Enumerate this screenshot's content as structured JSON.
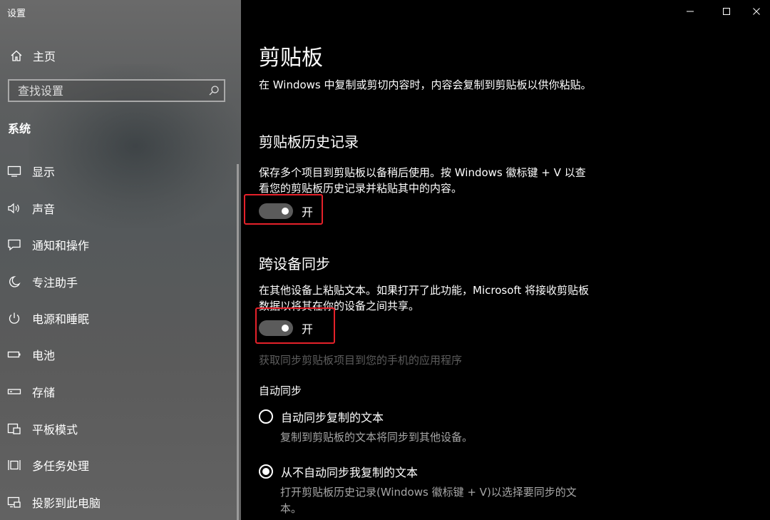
{
  "window": {
    "title": "设置",
    "controls": [
      "minimize",
      "maximize",
      "close"
    ]
  },
  "sidebar": {
    "home_label": "主页",
    "search_placeholder": "查找设置",
    "section_label": "系统",
    "items": [
      {
        "label": "显示",
        "icon": "display-icon"
      },
      {
        "label": "声音",
        "icon": "speaker-icon"
      },
      {
        "label": "通知和操作",
        "icon": "notification-icon"
      },
      {
        "label": "专注助手",
        "icon": "moon-icon"
      },
      {
        "label": "电源和睡眠",
        "icon": "power-icon"
      },
      {
        "label": "电池",
        "icon": "battery-icon"
      },
      {
        "label": "存储",
        "icon": "storage-icon"
      },
      {
        "label": "平板模式",
        "icon": "tablet-icon"
      },
      {
        "label": "多任务处理",
        "icon": "multitask-icon"
      },
      {
        "label": "投影到此电脑",
        "icon": "project-icon"
      }
    ]
  },
  "main": {
    "title": "剪贴板",
    "intro": "在 Windows 中复制或剪切内容时，内容会复制到剪贴板以供你粘贴。",
    "history": {
      "title": "剪贴板历史记录",
      "desc": "保存多个项目到剪贴板以备稍后使用。按 Windows 徽标键 + V 以查看您的剪贴板历史记录并粘贴其中的内容。",
      "toggle_state": "开",
      "toggle_on": true
    },
    "sync": {
      "title": "跨设备同步",
      "desc": "在其他设备上粘贴文本。如果打开了此功能，Microsoft 将接收剪贴板数据以将其在你的设备之间共享。",
      "toggle_state": "开",
      "toggle_on": true,
      "phone_link": "获取同步剪贴板项目到您的手机的应用程序",
      "auto_sync_label": "自动同步",
      "options": [
        {
          "label": "自动同步复制的文本",
          "desc": "复制到剪贴板的文本将同步到其他设备。",
          "selected": false
        },
        {
          "label": "从不自动同步我复制的文本",
          "desc": "打开剪贴板历史记录(Windows 徽标键 + V)以选择要同步的文本。",
          "selected": true
        }
      ]
    }
  },
  "colors": {
    "highlight_box": "#e5212a",
    "background": "#000000",
    "toggle_track": "#5b5b5b",
    "dim_text": "#5d5d5d",
    "secondary_text": "#a6a6a6"
  }
}
